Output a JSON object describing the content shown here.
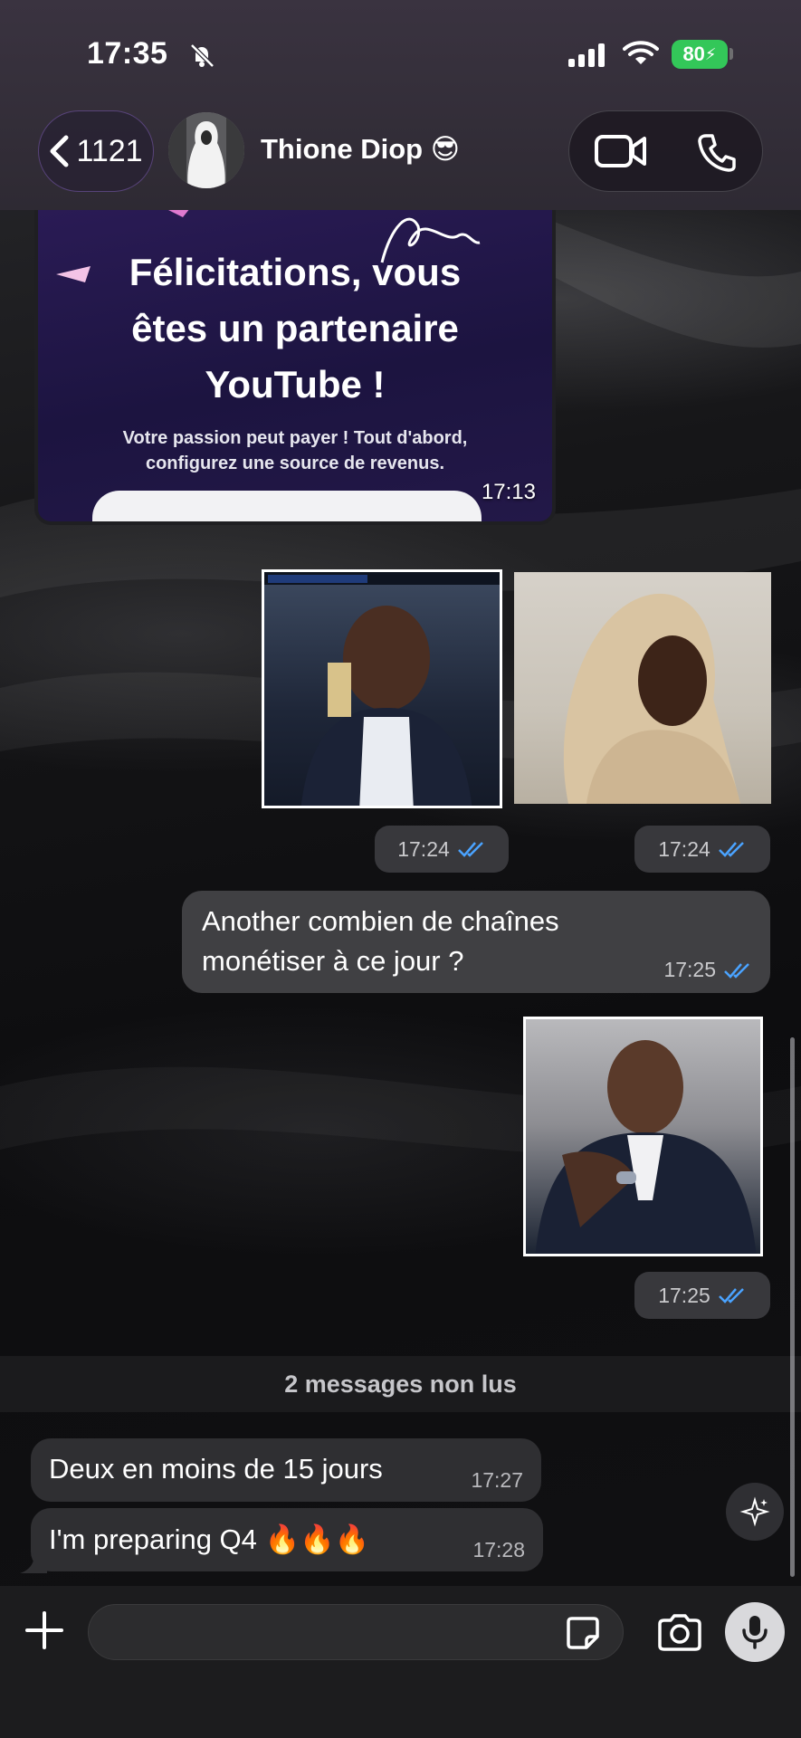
{
  "status_bar": {
    "time": "17:35",
    "battery": "80"
  },
  "header": {
    "back_count": "1121",
    "contact_name": "Thione Diop 😎"
  },
  "messages": {
    "youtube_card": {
      "title_line1": "Félicitations, vous",
      "title_line2": "êtes un partenaire",
      "title_line3": "YouTube !",
      "subtitle_line1": "Votre passion peut payer ! Tout d'abord,",
      "subtitle_line2": "configurez une source de revenus.",
      "time": "17:13"
    },
    "photo_times": [
      "17:24",
      "17:24"
    ],
    "outgoing_text": {
      "line1": "Another combien de chaînes",
      "line2": "monétiser à ce jour ?",
      "time": "17:25"
    },
    "photo3_time": "17:25",
    "unread_divider": "2 messages non lus",
    "incoming": [
      {
        "text": "Deux en moins de 15 jours",
        "time": "17:27"
      },
      {
        "text": "I'm preparing Q4 🔥🔥🔥",
        "time": "17:28"
      }
    ]
  },
  "composer": {
    "placeholder": ""
  },
  "colors": {
    "read_ticks": "#4aa3ff",
    "battery": "#33c759",
    "header": "#322d38"
  }
}
